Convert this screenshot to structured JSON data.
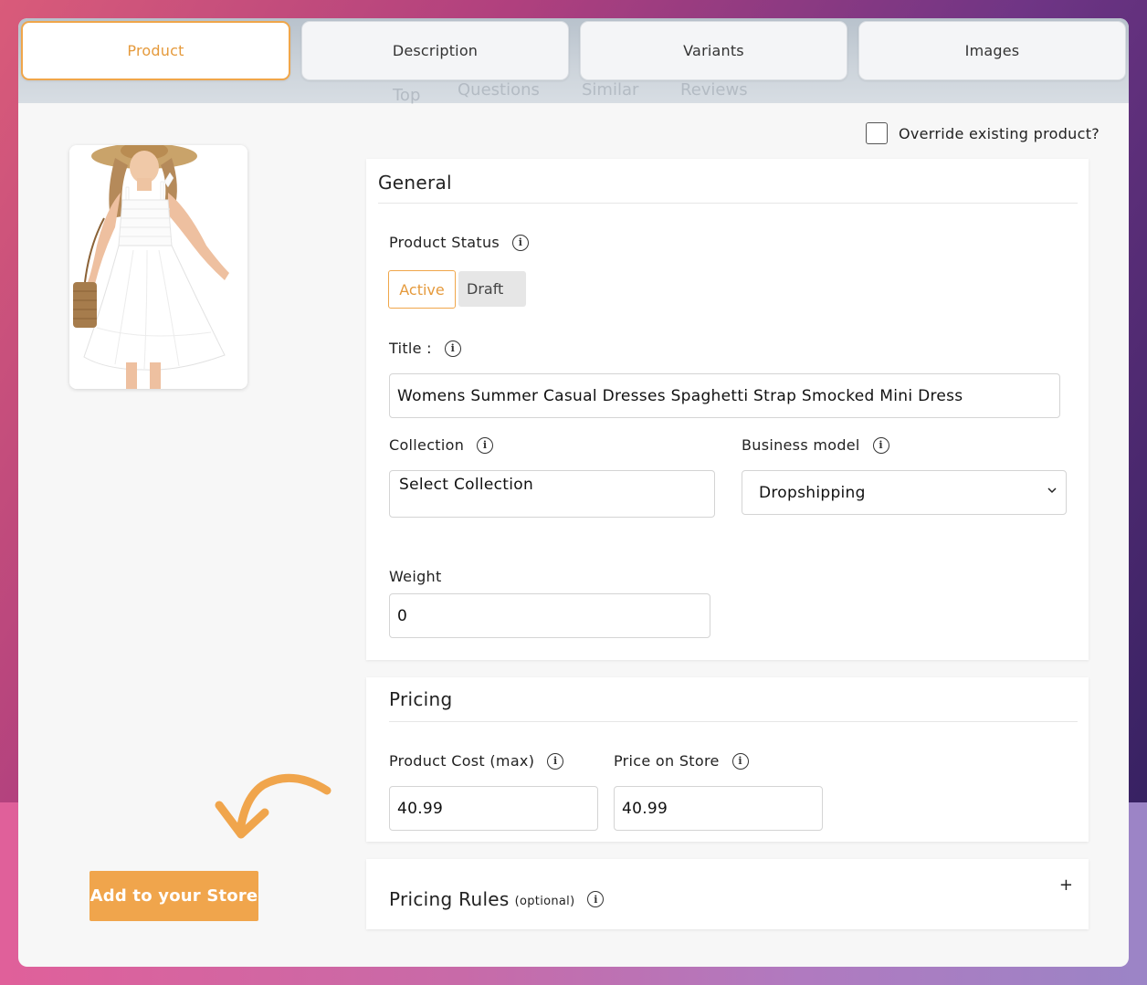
{
  "tabs": [
    {
      "label": "Product",
      "active": true
    },
    {
      "label": "Description",
      "active": false
    },
    {
      "label": "Variants",
      "active": false
    },
    {
      "label": "Images",
      "active": false
    }
  ],
  "subtabs": [
    "Top",
    "Questions",
    "Similar",
    "Reviews"
  ],
  "product_image": {
    "icon": "white-dress-image"
  },
  "override": {
    "label": "Override existing product?",
    "checked": false
  },
  "general": {
    "title": "General",
    "status_label": "Product Status",
    "status_options": [
      "Active",
      "Draft"
    ],
    "status_selected": "Active",
    "title_label": "Title :",
    "title_value": "Womens Summer Casual Dresses Spaghetti Strap Smocked Mini Dress",
    "collection_label": "Collection",
    "collection_value": "Select Collection",
    "business_model_label": "Business model",
    "business_model_value": "Dropshipping",
    "weight_label": "Weight",
    "weight_value": "0"
  },
  "pricing": {
    "title": "Pricing",
    "cost_label": "Product Cost (max)",
    "cost_value": "40.99",
    "price_label": "Price on Store",
    "price_value": "40.99"
  },
  "pricing_rules": {
    "title": "Pricing Rules",
    "optional": "(optional)",
    "expand_icon": "+"
  },
  "add_button": "Add to your Store",
  "colors": {
    "accent": "#f0a54c",
    "accent_text": "#e59a3c"
  }
}
